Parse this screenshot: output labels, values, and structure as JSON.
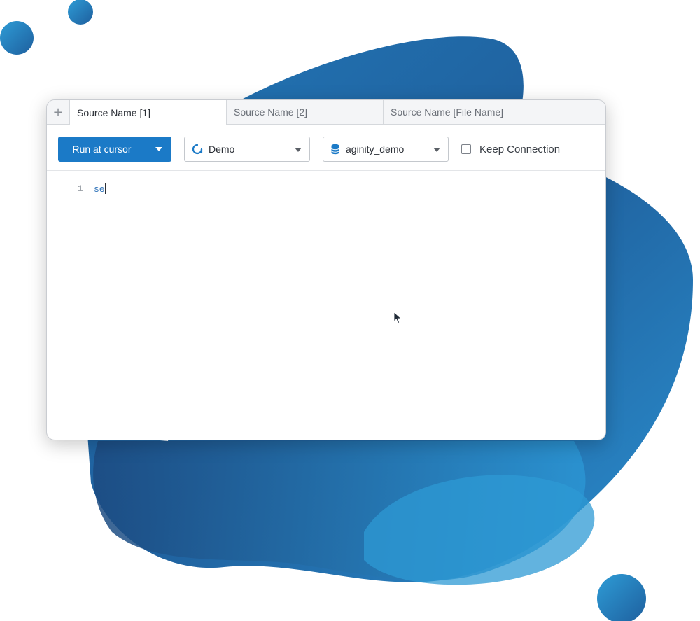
{
  "colors": {
    "accent": "#1b7ac7",
    "blob_dark": "#1c4f86",
    "blob_light": "#2e9cd6"
  },
  "tabs": [
    {
      "label": "Source Name [1]",
      "active": true
    },
    {
      "label": "Source Name [2]",
      "active": false
    },
    {
      "label": "Source Name [File Name]",
      "active": false
    }
  ],
  "toolbar": {
    "add_tab_icon": "plus-icon",
    "run_label": "Run at cursor",
    "run_dropdown_icon": "chevron-down-icon",
    "connection": {
      "value": "Demo",
      "icon": "connection-ring-icon"
    },
    "database": {
      "value": "aginity_demo",
      "icon": "database-icon"
    },
    "keep_connection": {
      "label": "Keep Connection",
      "checked": false
    }
  },
  "editor": {
    "line_number": "1",
    "code_text": "se"
  }
}
